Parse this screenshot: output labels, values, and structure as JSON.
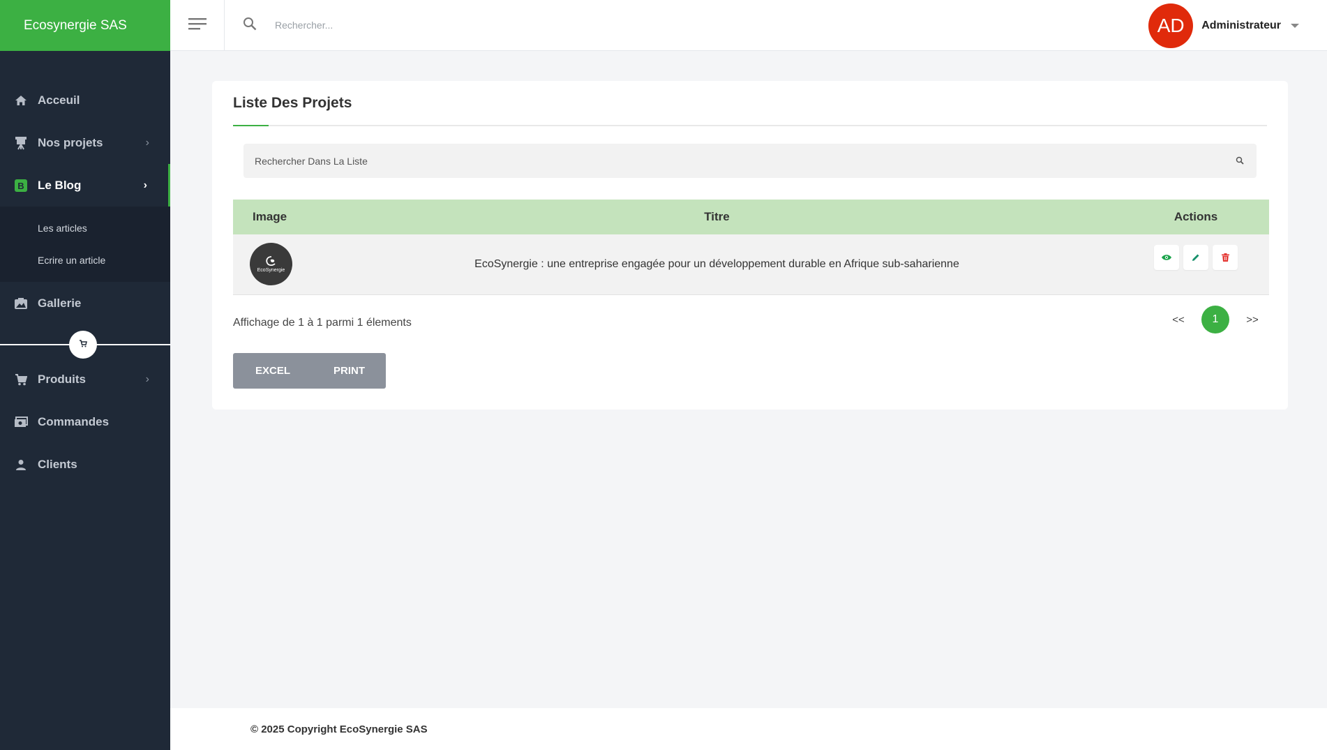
{
  "sidebar": {
    "brand": "Ecosynergie SAS",
    "items": [
      {
        "label": "Acceuil",
        "icon": "home-icon"
      },
      {
        "label": "Nos projets",
        "icon": "projector-icon"
      },
      {
        "label": "Le Blog",
        "icon": "blog-icon",
        "active": true
      },
      {
        "label": "Gallerie",
        "icon": "gallery-icon"
      },
      {
        "label": "Produits",
        "icon": "cart-icon"
      },
      {
        "label": "Commandes",
        "icon": "money-icon"
      },
      {
        "label": "Clients",
        "icon": "person-icon"
      }
    ],
    "blog_submenu": [
      "Les articles",
      "Ecrire un article"
    ]
  },
  "topbar": {
    "search_placeholder": "Rechercher...",
    "avatar_initials": "AD",
    "avatar_color": "#e02a0b",
    "user_name": "Administrateur"
  },
  "card": {
    "title": "Liste Des Projets",
    "search_placeholder": "Rechercher Dans La Liste",
    "table": {
      "columns": [
        "Image",
        "Titre",
        "Actions"
      ],
      "rows": [
        {
          "thumb_text": "EcoSynergie",
          "title": "EcoSynergie : une entreprise engagée pour un développement durable en Afrique sub-saharienne"
        }
      ]
    },
    "info": "Affichage de 1 à 1 parmi 1 élements",
    "pagination": {
      "prev": "<<",
      "current": "1",
      "next": ">>"
    },
    "export": {
      "excel": "EXCEL",
      "print": "PRINT"
    }
  },
  "footer": {
    "copyright": "© 2025 Copyright EcoSynergie SAS"
  },
  "colors": {
    "brand_green": "#3cb043",
    "sidebar_bg": "#1f2937",
    "table_header": "#c4e3bc",
    "view": "#1aa34a",
    "edit": "#15906a",
    "delete": "#e53935"
  }
}
